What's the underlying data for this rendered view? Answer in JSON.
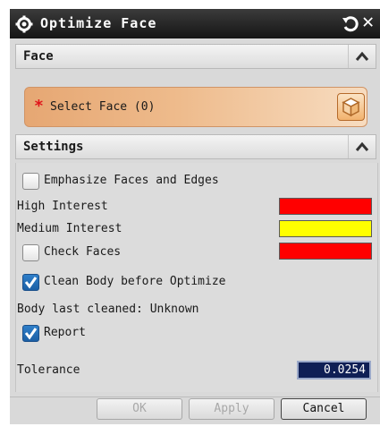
{
  "dialog": {
    "title": "Optimize Face",
    "icons": {
      "app": "gear-icon",
      "reset": "reset-icon",
      "close": "close-icon"
    }
  },
  "face_section": {
    "header": "Face",
    "select_label": "Select Face (0)",
    "required_marker": "*"
  },
  "settings_section": {
    "header": "Settings",
    "emphasize_label": "Emphasize Faces and Edges",
    "emphasize_checked": false,
    "high_interest_label": "High Interest",
    "high_interest_color": "#ff0000",
    "medium_interest_label": "Medium Interest",
    "medium_interest_color": "#ffff00",
    "check_faces_label": "Check Faces",
    "check_faces_checked": false,
    "check_faces_color": "#ff0000",
    "clean_body_label": "Clean Body before Optimize",
    "clean_body_checked": true,
    "last_cleaned_text": "Body last cleaned: Unknown",
    "report_label": "Report",
    "report_checked": true,
    "tolerance_label": "Tolerance",
    "tolerance_value": "0.0254"
  },
  "buttons": {
    "ok": "OK",
    "apply": "Apply",
    "cancel": "Cancel"
  }
}
